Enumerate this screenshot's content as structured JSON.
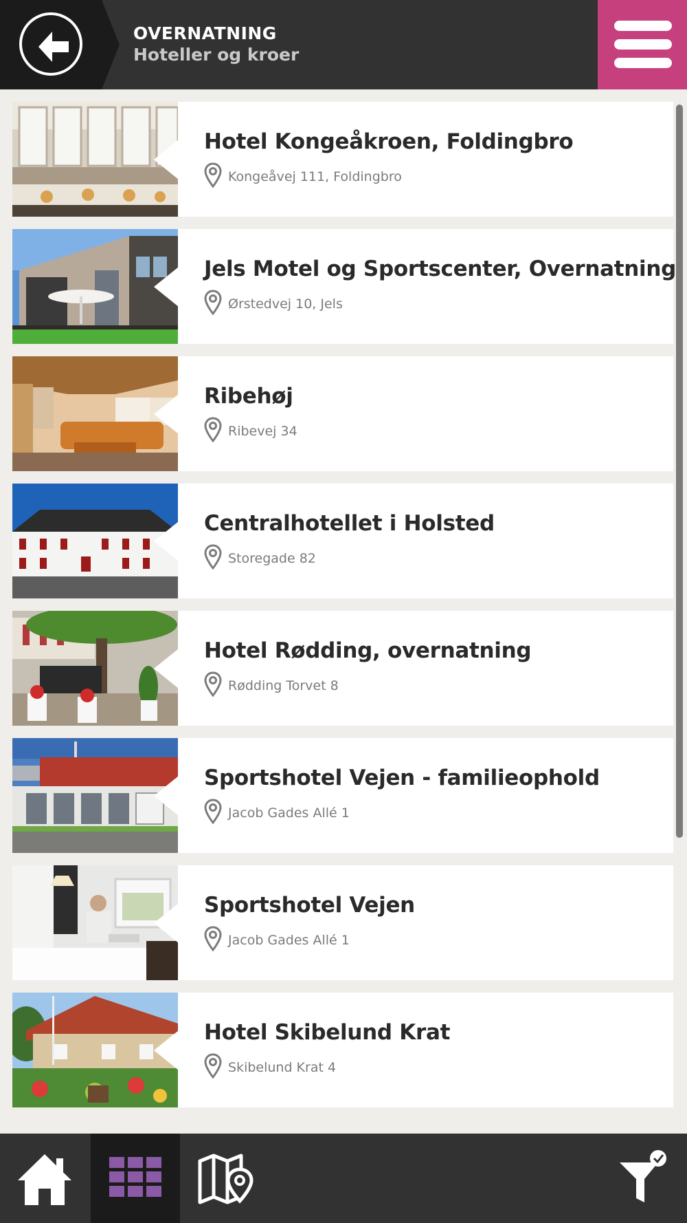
{
  "header": {
    "title": "OVERNATNING",
    "subtitle": "Hoteller og kroer",
    "back_icon": "arrow-left-icon",
    "menu_icon": "hamburger-menu-icon",
    "accent_color": "#c6407e"
  },
  "list": {
    "items": [
      {
        "name": "Hotel Kongeåkroen, Foldingbro",
        "address": "Kongeåvej 111, Foldingbro"
      },
      {
        "name": "Jels Motel og Sportscenter, Overnatning",
        "address": "Ørstedvej 10, Jels"
      },
      {
        "name": "Ribehøj",
        "address": "Ribevej 34"
      },
      {
        "name": "Centralhotellet i Holsted",
        "address": "Storegade 82"
      },
      {
        "name": "Hotel Rødding, overnatning",
        "address": "Rødding Torvet 8"
      },
      {
        "name": "Sportshotel Vejen - familieophold",
        "address": "Jacob Gades Allé 1"
      },
      {
        "name": "Sportshotel Vejen",
        "address": "Jacob Gades Allé 1"
      },
      {
        "name": "Hotel Skibelund Krat",
        "address": "Skibelund Krat 4"
      }
    ]
  },
  "bottom_nav": {
    "items": [
      "home-icon",
      "grid-icon",
      "map-icon",
      "filter-icon"
    ],
    "active": "grid-icon",
    "active_color": "#8b5aa6"
  }
}
